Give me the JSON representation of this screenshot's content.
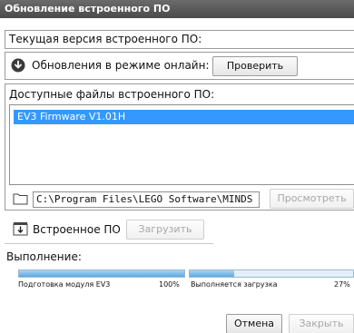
{
  "window": {
    "title": "Обновление встроенного ПО"
  },
  "current_version": {
    "label": "Текущая версия встроенного ПО:"
  },
  "online": {
    "label": "Обновления в режиме онлайн:",
    "check_button": "Проверить"
  },
  "available": {
    "label": "Доступные файлы встроенного ПО:",
    "items": [
      "EV3 Firmware V1.01H"
    ]
  },
  "browse": {
    "path_value": "C:\\Program Files\\LEGO Software\\MINDS",
    "browse_button": "Просмотреть"
  },
  "firmware": {
    "label": "Встроенное ПО",
    "download_button": "Загрузить"
  },
  "progress": {
    "label": "Выполнение:",
    "left": {
      "text": "Подготовка модуля EV3",
      "percent_text": "100%",
      "value": 1.0
    },
    "right": {
      "text": "Выполняется загрузка",
      "percent_text": "27%",
      "value": 0.27
    }
  },
  "footer": {
    "cancel_button": "Отмена",
    "close_button": "Закрыть"
  },
  "colors": {
    "selection": "#3399ff",
    "titlebar": "#555555",
    "progress_fill": "#5aa9e2"
  }
}
